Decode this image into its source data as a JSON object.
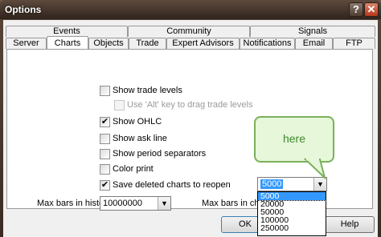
{
  "window": {
    "title": "Options"
  },
  "tabs": {
    "row1": [
      "Events",
      "Community",
      "Signals"
    ],
    "row2": [
      "Server",
      "Charts",
      "Objects",
      "Trade",
      "Expert Advisors",
      "Notifications",
      "Email",
      "FTP"
    ]
  },
  "options": [
    {
      "label": "Show trade levels",
      "checked": false,
      "disabled": false
    },
    {
      "label": "Use 'Alt' key to drag trade levels",
      "checked": false,
      "disabled": true
    },
    {
      "label": "Show OHLC",
      "checked": true,
      "disabled": false
    },
    {
      "label": "Show ask line",
      "checked": false,
      "disabled": false
    },
    {
      "label": "Show period separators",
      "checked": false,
      "disabled": false
    },
    {
      "label": "Color print",
      "checked": false,
      "disabled": false
    },
    {
      "label": "Save deleted charts to reopen",
      "checked": true,
      "disabled": false
    }
  ],
  "max_bars_history": {
    "label": "Max bars in history:",
    "value": "10000000"
  },
  "max_bars_chart": {
    "label": "Max bars in chart:",
    "value": "5000",
    "options": [
      "5000",
      "20000",
      "50000",
      "100000",
      "250000"
    ]
  },
  "buttons": {
    "ok": "OK",
    "help": "Help"
  },
  "callout": {
    "text": "here"
  },
  "colors": {
    "callout_border": "#7ab05a",
    "callout_fill": "#e6f7da",
    "selection": "#3399ff"
  }
}
